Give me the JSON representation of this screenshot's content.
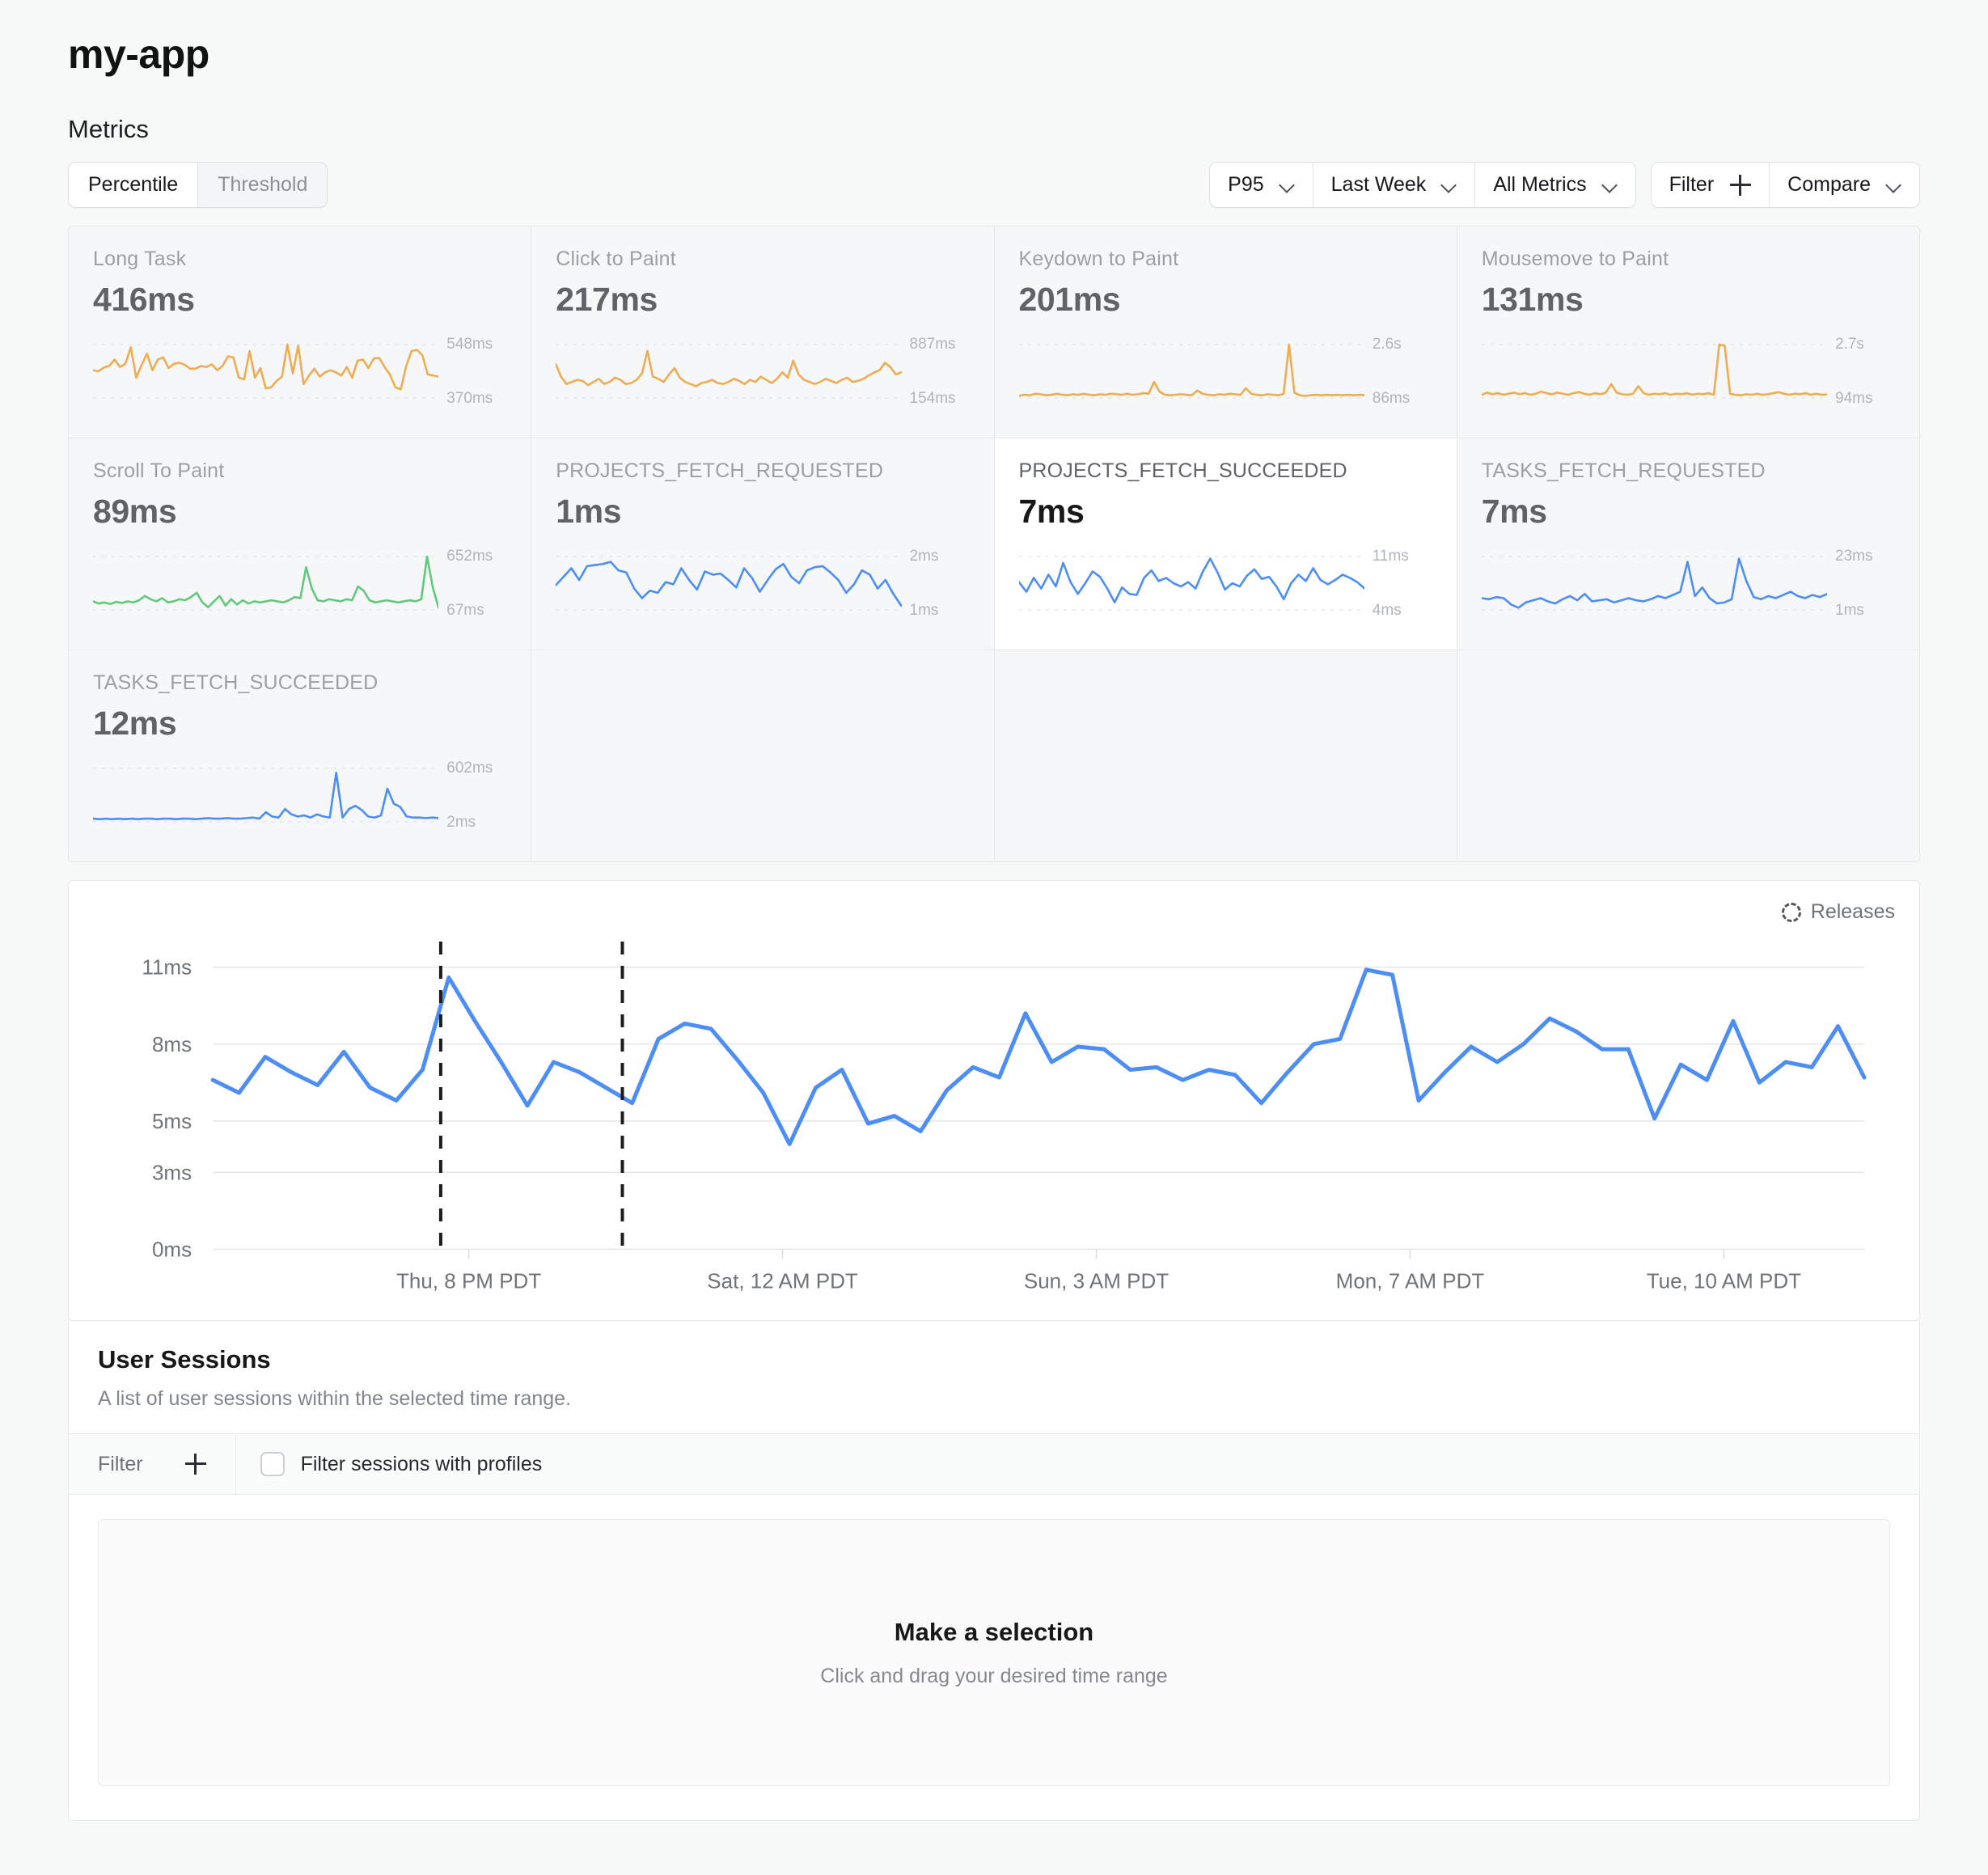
{
  "header": {
    "app_title": "my-app",
    "section_label": "Metrics"
  },
  "toolbar": {
    "segments": [
      {
        "label": "Percentile",
        "active": true
      },
      {
        "label": "Threshold",
        "active": false
      }
    ],
    "percentile": "P95",
    "time_range": "Last Week",
    "metric_scope": "All Metrics",
    "filter_label": "Filter",
    "compare_label": "Compare"
  },
  "metric_cards": [
    {
      "title": "Long Task",
      "value": "416ms",
      "max": "548ms",
      "min": "370ms",
      "color": "#eeac53",
      "selected": false,
      "points": [
        52,
        50,
        57,
        60,
        72,
        58,
        64,
        95,
        38,
        62,
        83,
        52,
        72,
        76,
        56,
        64,
        66,
        62,
        55,
        55,
        60,
        58,
        63,
        52,
        60,
        78,
        76,
        38,
        35,
        88,
        38,
        56,
        18,
        20,
        32,
        40,
        100,
        46,
        98,
        26,
        42,
        55,
        40,
        48,
        52,
        48,
        42,
        58,
        38,
        70,
        72,
        56,
        74,
        75,
        58,
        44,
        20,
        16,
        60,
        88,
        90,
        80,
        44,
        42,
        40
      ]
    },
    {
      "title": "Click to Paint",
      "value": "217ms",
      "max": "887ms",
      "min": "154ms",
      "color": "#eeac53",
      "selected": false,
      "points": [
        64,
        40,
        26,
        30,
        34,
        32,
        24,
        30,
        36,
        26,
        30,
        38,
        34,
        26,
        28,
        34,
        46,
        88,
        40,
        36,
        30,
        44,
        56,
        38,
        30,
        26,
        22,
        28,
        30,
        34,
        28,
        26,
        30,
        36,
        32,
        26,
        34,
        30,
        40,
        34,
        28,
        36,
        48,
        38,
        70,
        44,
        34,
        30,
        26,
        30,
        36,
        32,
        28,
        34,
        38,
        30,
        32,
        36,
        42,
        48,
        52,
        66,
        58,
        44,
        48
      ]
    },
    {
      "title": "Keydown to Paint",
      "value": "201ms",
      "max": "2.6s",
      "min": "86ms",
      "color": "#eeac53",
      "selected": false,
      "points": [
        4,
        6,
        5,
        8,
        7,
        5,
        6,
        8,
        6,
        5,
        7,
        6,
        8,
        6,
        5,
        7,
        6,
        8,
        7,
        6,
        8,
        6,
        7,
        9,
        8,
        30,
        12,
        6,
        5,
        6,
        7,
        6,
        5,
        14,
        8,
        6,
        5,
        7,
        6,
        8,
        7,
        6,
        18,
        8,
        6,
        5,
        7,
        6,
        5,
        8,
        100,
        10,
        5,
        4,
        5,
        6,
        5,
        6,
        5,
        6,
        5,
        6,
        5,
        6,
        5
      ]
    },
    {
      "title": "Mousemove to Paint",
      "value": "131ms",
      "max": "2.7s",
      "min": "94ms",
      "color": "#eeac53",
      "selected": false,
      "points": [
        6,
        10,
        7,
        9,
        6,
        8,
        10,
        7,
        9,
        6,
        8,
        12,
        9,
        7,
        10,
        8,
        6,
        9,
        11,
        8,
        6,
        9,
        7,
        10,
        26,
        10,
        7,
        6,
        8,
        22,
        9,
        6,
        8,
        7,
        9,
        6,
        8,
        7,
        9,
        6,
        8,
        7,
        9,
        6,
        100,
        98,
        8,
        6,
        5,
        7,
        6,
        8,
        6,
        7,
        9,
        11,
        8,
        6,
        8,
        7,
        9,
        6,
        8,
        6,
        7
      ]
    },
    {
      "title": "Scroll To Paint",
      "value": "89ms",
      "max": "652ms",
      "min": "67ms",
      "color": "#63c97a",
      "selected": false,
      "points": [
        16,
        12,
        14,
        11,
        15,
        13,
        16,
        14,
        18,
        26,
        20,
        16,
        22,
        14,
        16,
        20,
        18,
        24,
        32,
        14,
        5,
        16,
        26,
        8,
        20,
        10,
        18,
        12,
        16,
        14,
        16,
        18,
        16,
        14,
        18,
        24,
        22,
        80,
        40,
        18,
        16,
        20,
        18,
        16,
        20,
        18,
        44,
        36,
        18,
        14,
        16,
        18,
        16,
        14,
        16,
        18,
        16,
        20,
        100,
        42,
        4
      ]
    },
    {
      "title": "PROJECTS_FETCH_REQUESTED",
      "value": "1ms",
      "max": "2ms",
      "min": "1ms",
      "color": "#4c8ef5",
      "selected": false,
      "points": [
        46,
        62,
        78,
        56,
        82,
        84,
        86,
        90,
        74,
        70,
        40,
        22,
        36,
        32,
        52,
        48,
        78,
        56,
        38,
        72,
        66,
        68,
        56,
        42,
        78,
        60,
        34,
        56,
        76,
        86,
        62,
        50,
        74,
        80,
        82,
        70,
        56,
        32,
        48,
        74,
        66,
        40,
        56,
        30,
        8
      ]
    },
    {
      "title": "PROJECTS_FETCH_SUCCEEDED",
      "value": "7ms",
      "max": "11ms",
      "min": "4ms",
      "color": "#4c8ef5",
      "selected": true,
      "points": [
        52,
        34,
        60,
        40,
        66,
        44,
        88,
        52,
        30,
        50,
        72,
        62,
        40,
        14,
        42,
        30,
        28,
        60,
        74,
        54,
        60,
        50,
        44,
        52,
        40,
        72,
        96,
        70,
        38,
        50,
        44,
        64,
        76,
        58,
        62,
        44,
        20,
        50,
        66,
        54,
        78,
        56,
        48,
        56,
        66,
        60,
        52,
        40
      ]
    },
    {
      "title": "TASKS_FETCH_REQUESTED",
      "value": "7ms",
      "max": "23ms",
      "min": "1ms",
      "color": "#4c8ef5",
      "selected": false,
      "points": [
        22,
        20,
        24,
        22,
        10,
        4,
        14,
        18,
        22,
        16,
        12,
        20,
        26,
        18,
        30,
        16,
        18,
        20,
        14,
        18,
        22,
        18,
        16,
        20,
        26,
        22,
        28,
        34,
        90,
        26,
        42,
        22,
        12,
        14,
        20,
        96,
        54,
        24,
        20,
        26,
        22,
        28,
        34,
        26,
        22,
        28,
        24,
        30
      ]
    },
    {
      "title": "TASKS_FETCH_SUCCEEDED",
      "value": "12ms",
      "max": "602ms",
      "min": "2ms",
      "color": "#4c8ef5",
      "selected": false,
      "points": [
        6,
        5,
        6,
        5,
        6,
        5,
        6,
        5,
        6,
        6,
        5,
        6,
        6,
        5,
        6,
        6,
        5,
        6,
        7,
        6,
        6,
        7,
        6,
        6,
        7,
        8,
        6,
        18,
        10,
        8,
        24,
        14,
        10,
        12,
        8,
        14,
        10,
        8,
        92,
        8,
        24,
        30,
        22,
        10,
        8,
        12,
        62,
        34,
        28,
        10,
        8,
        8,
        7,
        8,
        7
      ]
    },
    {
      "title": "",
      "value": "",
      "max": "",
      "min": "",
      "color": "",
      "selected": false,
      "empty": true
    },
    {
      "title": "",
      "value": "",
      "max": "",
      "min": "",
      "color": "",
      "selected": false,
      "empty": true
    },
    {
      "title": "",
      "value": "",
      "max": "",
      "min": "",
      "color": "",
      "selected": false,
      "empty": true
    }
  ],
  "main_chart": {
    "releases_label": "Releases"
  },
  "sessions": {
    "title": "User Sessions",
    "subtitle": "A list of user sessions within the selected time range.",
    "filter_label": "Filter",
    "profiles_label": "Filter sessions with profiles",
    "empty_title": "Make a selection",
    "empty_sub": "Click and drag your desired time range"
  },
  "chart_data": {
    "type": "line",
    "title": "",
    "xlabel": "",
    "ylabel": "",
    "ylim": [
      0,
      12
    ],
    "grid": true,
    "legend": "none",
    "line_color": "#4c8ef5",
    "y_ticks": [
      "0ms",
      "3ms",
      "5ms",
      "8ms",
      "11ms"
    ],
    "y_tick_values": [
      0,
      3,
      5,
      8,
      11
    ],
    "x_ticks": [
      "Thu, 8 PM PDT",
      "Sat, 12 AM PDT",
      "Sun, 3 AM PDT",
      "Mon, 7 AM PDT",
      "Tue, 10 AM PDT"
    ],
    "x_tick_positions": [
      0.155,
      0.345,
      0.535,
      0.725,
      0.915
    ],
    "release_markers": [
      0.138,
      0.248
    ],
    "values": [
      6.6,
      6.1,
      7.5,
      6.9,
      6.4,
      7.7,
      6.3,
      5.8,
      7.0,
      10.6,
      8.9,
      7.3,
      5.6,
      7.3,
      6.9,
      6.3,
      5.7,
      8.2,
      8.8,
      8.6,
      7.4,
      6.1,
      4.1,
      6.3,
      7.0,
      4.9,
      5.2,
      4.6,
      6.2,
      7.1,
      6.7,
      9.2,
      7.3,
      7.9,
      7.8,
      7.0,
      7.1,
      6.6,
      7.0,
      6.8,
      5.7,
      6.9,
      8.0,
      8.2,
      10.9,
      10.7,
      5.8,
      6.9,
      7.9,
      7.3,
      8.0,
      9.0,
      8.5,
      7.8,
      7.8,
      5.1,
      7.2,
      6.6,
      8.9,
      6.5,
      7.3,
      7.1,
      8.7,
      6.7
    ]
  }
}
